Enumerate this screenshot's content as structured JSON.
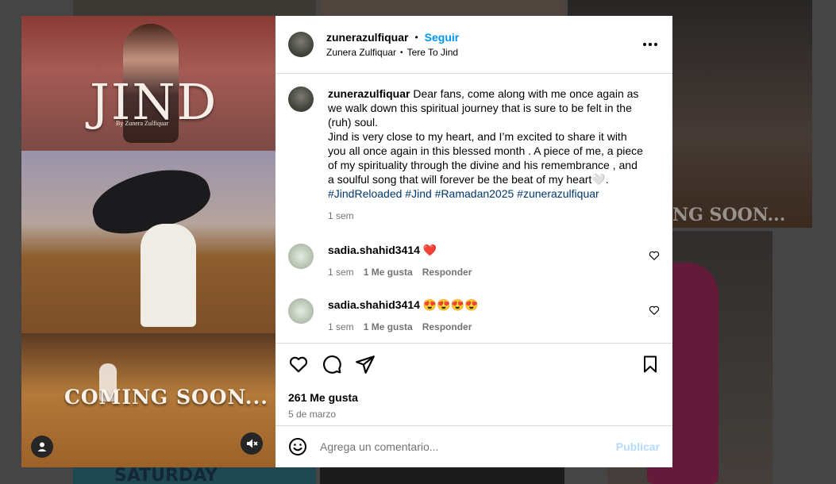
{
  "post": {
    "username": "zunerazulfiquar",
    "follow_label": "Seguir",
    "dot": "•",
    "audio_artist": "Zunera Zulfiquar",
    "audio_track": "Tere To Jind"
  },
  "media": {
    "title": "JIND",
    "subtitle": "By Zunera Zulfiquar",
    "banner": "COMING SOON..."
  },
  "caption": {
    "username": "zunerazulfiquar",
    "text1": "Dear fans, come along with me once again as we walk down this spiritual journey that is sure to be felt in the (ruh) soul.",
    "text2": "Jind is very close to my heart, and I’m excited to share it with you all once again in this blessed month . A piece of me, a piece of my spirituality through the divine and his remembrance , and a soulful song that will forever be the beat of my heart🤍.",
    "hashtags": "#JindReloaded #Jind #Ramadan2025 #zunerazulfiquar",
    "time": "1 sem"
  },
  "comments": [
    {
      "username": "sadia.shahid3414",
      "text": "❤️",
      "time": "1 sem",
      "likes": "1 Me gusta",
      "reply": "Responder"
    },
    {
      "username": "sadia.shahid3414",
      "text": "😍😍😍😍",
      "time": "1 sem",
      "likes": "1 Me gusta",
      "reply": "Responder"
    }
  ],
  "actions": {
    "likes": "261 Me gusta",
    "date": "5 de marzo"
  },
  "composer": {
    "placeholder": "Agrega un comentario...",
    "publish": "Publicar"
  },
  "background_partial_text": {
    "right_tile": "NG SOON...",
    "bottom_tile": "SATURDAY"
  }
}
